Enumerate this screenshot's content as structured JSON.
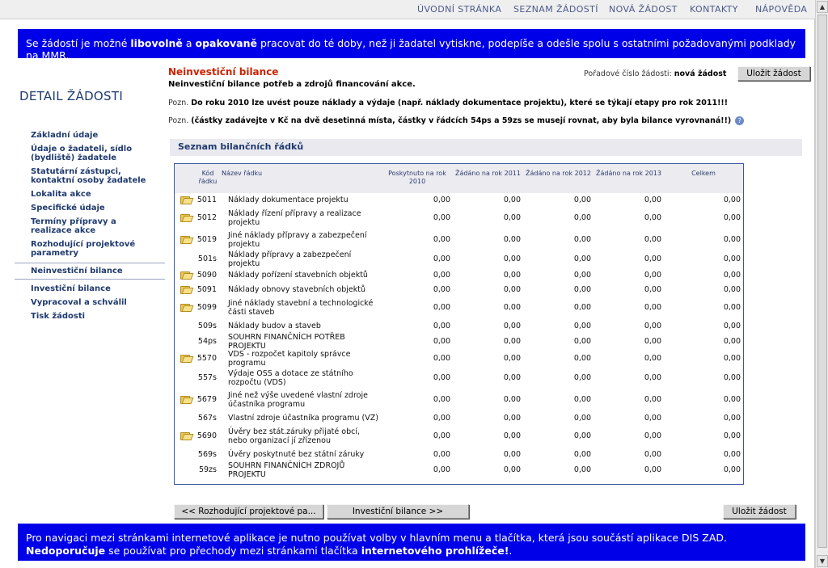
{
  "topnav": {
    "items": [
      "ÚVODNÍ STRÁNKA",
      "SEZNAM ŽÁDOSTÍ",
      "NOVÁ ŽÁDOST",
      "KONTAKTY",
      "NÁPOVĚDA"
    ]
  },
  "banner_top": {
    "t1": "Se žádostí je možné ",
    "b1": "libovolně",
    "t2": " a ",
    "b2": "opakovaně",
    "t3": " pracovat do té doby, než ji žadatel vytiskne, podepíše a odešle spolu s ostatními požadovanými podklady na MMR."
  },
  "sidebar": {
    "title": "DETAIL ŽÁDOSTI",
    "items": [
      {
        "label": "Základní údaje"
      },
      {
        "label": "Údaje o žadateli, sídlo (bydliště) žadatele"
      },
      {
        "label": "Statutární zástupci, kontaktní osoby žadatele"
      },
      {
        "label": "Lokalita akce"
      },
      {
        "label": "Specifické údaje"
      },
      {
        "label": "Termíny přípravy a realizace akce"
      },
      {
        "label": "Rozhodující projektové parametry"
      },
      {
        "label": "Neinvestiční bilance",
        "active": true
      },
      {
        "label": "Investiční bilance"
      },
      {
        "label": "Vypracoval a schválil"
      },
      {
        "label": "Tisk žádosti"
      }
    ]
  },
  "main": {
    "title": "Neinvestiční bilance",
    "subtitle": "Neinvestiční bilance potřeb a zdrojů financování akce.",
    "note1_prefix": "Pozn.",
    "note1_text": "Do roku 2010 lze uvést pouze náklady a výdaje (např. náklady dokumentace projektu), které se týkají etapy pro rok 2011!!!",
    "note2_prefix": "Pozn.",
    "note2_text": "(částky zadávejte v Kč na dvě desetinná místa, částky v řádcích 54ps a 59zs se musejí rovnat, aby byla bilance vyrovnaná!!)",
    "help_glyph": "?",
    "request_number_label": "Pořadové číslo žádosti:",
    "request_number_value": "nová žádost",
    "save_label": "Uložit žádost",
    "list_title": "Seznam bilančních řádků"
  },
  "table": {
    "headers": {
      "code": "Kód řádku",
      "name": "Název řádku",
      "c2010": "Poskytnuto na rok 2010",
      "c2011": "Žádáno na rok 2011",
      "c2012": "Žádáno na rok 2012",
      "c2013": "Žádáno na rok 2013",
      "total": "Celkem"
    },
    "rows": [
      {
        "icon": true,
        "code": "5011",
        "name": "Náklady dokumentace projektu",
        "v": [
          "0,00",
          "0,00",
          "0,00",
          "0,00",
          "0,00"
        ]
      },
      {
        "icon": true,
        "code": "5012",
        "name": "Náklady řízení přípravy a realizace projektu",
        "v": [
          "0,00",
          "0,00",
          "0,00",
          "0,00",
          "0,00"
        ]
      },
      {
        "icon": true,
        "code": "5019",
        "name": "Jiné náklady přípravy a zabezpečení projektu",
        "v": [
          "0,00",
          "0,00",
          "0,00",
          "0,00",
          "0,00"
        ]
      },
      {
        "icon": false,
        "code": "501s",
        "name": "Náklady přípravy a zabezpečení projektu",
        "v": [
          "0,00",
          "0,00",
          "0,00",
          "0,00",
          "0,00"
        ]
      },
      {
        "icon": true,
        "code": "5090",
        "name": "Náklady pořízení stavebních objektů",
        "v": [
          "0,00",
          "0,00",
          "0,00",
          "0,00",
          "0,00"
        ]
      },
      {
        "icon": true,
        "code": "5091",
        "name": "Náklady obnovy stavebních objektů",
        "v": [
          "0,00",
          "0,00",
          "0,00",
          "0,00",
          "0,00"
        ]
      },
      {
        "icon": true,
        "code": "5099",
        "name": "Jiné náklady stavební a technologické části staveb",
        "v": [
          "0,00",
          "0,00",
          "0,00",
          "0,00",
          "0,00"
        ]
      },
      {
        "icon": false,
        "code": "509s",
        "name": "Náklady budov a staveb",
        "v": [
          "0,00",
          "0,00",
          "0,00",
          "0,00",
          "0,00"
        ]
      },
      {
        "icon": false,
        "code": "54ps",
        "name": "SOUHRN FINANČNÍCH POTŘEB PROJEKTU",
        "v": [
          "0,00",
          "0,00",
          "0,00",
          "0,00",
          "0,00"
        ]
      },
      {
        "icon": true,
        "code": "5570",
        "name": "VDS - rozpočet kapitoly správce programu",
        "v": [
          "0,00",
          "0,00",
          "0,00",
          "0,00",
          "0,00"
        ]
      },
      {
        "icon": false,
        "code": "557s",
        "name": "Výdaje OSS a dotace ze státního rozpočtu (VDS)",
        "v": [
          "0,00",
          "0,00",
          "0,00",
          "0,00",
          "0,00"
        ]
      },
      {
        "icon": true,
        "code": "5679",
        "name": "Jiné než výše uvedené vlastní zdroje účastníka programu",
        "v": [
          "0,00",
          "0,00",
          "0,00",
          "0,00",
          "0,00"
        ]
      },
      {
        "icon": false,
        "code": "567s",
        "name": "Vlastní zdroje účastníka programu (VZ)",
        "v": [
          "0,00",
          "0,00",
          "0,00",
          "0,00",
          "0,00"
        ]
      },
      {
        "icon": true,
        "code": "5690",
        "name": "Úvěry bez stát.záruky přijaté obcí, nebo organizací jí zřízenou",
        "v": [
          "0,00",
          "0,00",
          "0,00",
          "0,00",
          "0,00"
        ]
      },
      {
        "icon": false,
        "code": "569s",
        "name": "Úvěry poskytnuté bez státní záruky",
        "v": [
          "0,00",
          "0,00",
          "0,00",
          "0,00",
          "0,00"
        ]
      },
      {
        "icon": false,
        "code": "59zs",
        "name": "SOUHRN FINANČNÍCH ZDROJŮ PROJEKTU",
        "v": [
          "0,00",
          "0,00",
          "0,00",
          "0,00",
          "0,00"
        ]
      }
    ]
  },
  "footer_buttons": {
    "prev": "<<  Rozhodující projektové pa...",
    "next": "Investiční bilance  >>",
    "save": "Uložit žádost"
  },
  "banner_bottom": {
    "t1": "Pro navigaci mezi stránkami internetové aplikace je nutno používat volby v hlavním menu a tlačítka, která jsou součástí aplikace DIS ZAD. ",
    "b1": "Nedoporučuje",
    "t2": " se používat pro přechody mezi stránkami tlačítka ",
    "b2": "internetového prohlížeče!",
    "t3": "."
  },
  "scrollbar": {
    "up": "▲",
    "down": "▼"
  }
}
